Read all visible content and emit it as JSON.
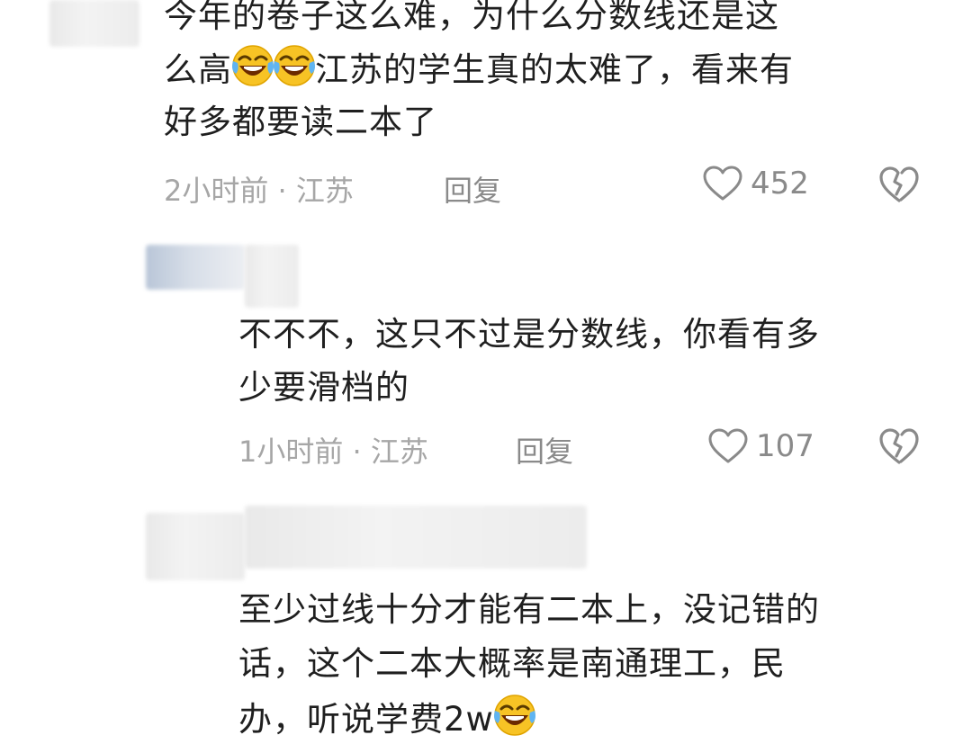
{
  "comments": [
    {
      "text_lines": [
        "今年的卷子这么难，为什么分数线还是这",
        "么高",
        "江苏的学生真的太难了，看来有",
        "好多都要读二本了"
      ],
      "meta": "2小时前 · 江苏",
      "reply_label": "回复",
      "likes": "452"
    },
    {
      "text_lines": [
        "不不不，这只不过是分数线，你看有多",
        "少要滑档的"
      ],
      "meta": "1小时前 · 江苏",
      "reply_label": "回复",
      "likes": "107"
    },
    {
      "text_lines": [
        "至少过线十分才能有二本上，没记错的",
        "话，这个二本大概率是南通理工，民",
        "办，听说学费2w"
      ]
    }
  ],
  "icons": {
    "like": "heart-outline-icon",
    "dislike": "broken-heart-icon",
    "emoji": "rolling-on-floor-laughing-emoji-icon"
  },
  "colors": {
    "text": "#1f1f1f",
    "meta": "#a6a6a6",
    "icon": "#8a8a8a",
    "emoji_face": "#f7c325"
  }
}
